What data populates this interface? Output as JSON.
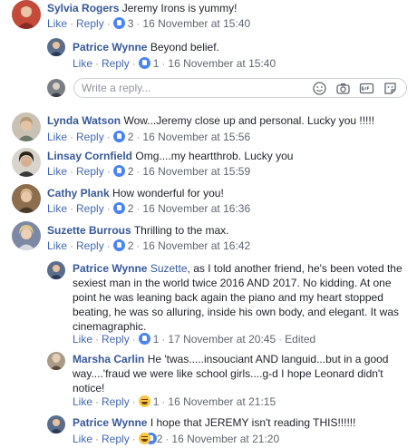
{
  "actions": {
    "like": "Like",
    "reply": "Reply",
    "edited": "Edited"
  },
  "reply_box": {
    "placeholder": "Write a reply..."
  },
  "comments": [
    {
      "author": "Sylvia Rogers",
      "text": "Jeremy Irons is yummy!",
      "reaction": "like",
      "count": "3",
      "time": "16 November at 15:40"
    },
    {
      "author": "Patrice Wynne",
      "text": "Beyond belief.",
      "reaction": "like",
      "count": "1",
      "time": "16 November at 15:40"
    },
    {
      "author": "Lynda Watson",
      "text": "Wow...Jeremy close up and personal. Lucky you !!!!!",
      "reaction": "like",
      "count": "2",
      "time": "16 November at 15:56"
    },
    {
      "author": "Linsay Cornfield",
      "text": "Omg....my heartthrob. Lucky you",
      "reaction": "like",
      "count": "2",
      "time": "16 November at 15:59"
    },
    {
      "author": "Cathy Plank",
      "text": "How wonderful for you!",
      "reaction": "like",
      "count": "2",
      "time": "16 November at 16:36"
    },
    {
      "author": "Suzette Burrous",
      "text": "Thrilling to the max.",
      "reaction": "like",
      "count": "2",
      "time": "16 November at 16:42"
    },
    {
      "author": "Patrice Wynne",
      "mention": "Suzette",
      "text": ", as I told another friend, he's been voted the sexiest man in the world twice 2016 AND 2017. No kidding. At one point he was leaning back again the piano and my heart stopped beating, he was so alluring, inside his own body, and elegant. It was cinemagraphic.",
      "reaction": "like",
      "count": "1",
      "time": "17 November at 20:45"
    },
    {
      "author": "Marsha Carlin",
      "text": "He 'twas.....insouciant AND languid...but in a good way....'fraud we were like school girls....g-d I hope Leonard didn't notice!",
      "reaction": "haha",
      "count": "1",
      "time": "16 November at 21:15"
    },
    {
      "author": "Patrice Wynne",
      "text": "I hope that JEREMY isn't reading THIS!!!!!!",
      "reaction": "haha-like",
      "count": "2",
      "time": "16 November at 21:20"
    }
  ]
}
